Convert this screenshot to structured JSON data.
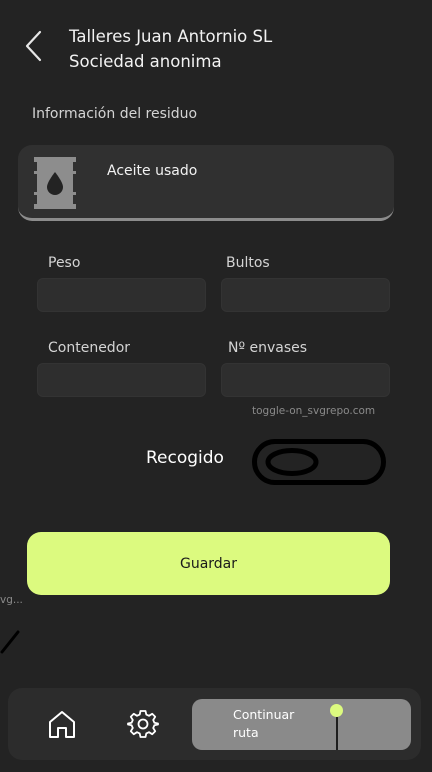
{
  "header": {
    "company_name": "Talleres Juan Antornio SL",
    "company_type": "Sociedad anonima"
  },
  "section": {
    "title": "Información del residuo"
  },
  "waste": {
    "name": "Aceite usado",
    "icon": "oil-barrel-icon"
  },
  "form": {
    "weight_label": "Peso",
    "weight_value": "",
    "packages_label": "Bultos",
    "packages_value": "",
    "container_label": "Contenedor",
    "container_value": "",
    "containers_count_label": "Nº envases",
    "containers_count_value": ""
  },
  "credits": {
    "toggle_credit": "toggle-on_svgrepo.com",
    "edge_credit": "vg..."
  },
  "toggle": {
    "label": "Recogido",
    "state": "on"
  },
  "actions": {
    "save_label": "Guardar"
  },
  "bottom_nav": {
    "home_icon": "home-icon",
    "settings_icon": "gear-icon",
    "continue_label": "Continuar ruta"
  },
  "colors": {
    "background": "#232323",
    "accent": "#dcfa7f",
    "card": "#303030",
    "continue_bg": "#8a8a8a"
  }
}
